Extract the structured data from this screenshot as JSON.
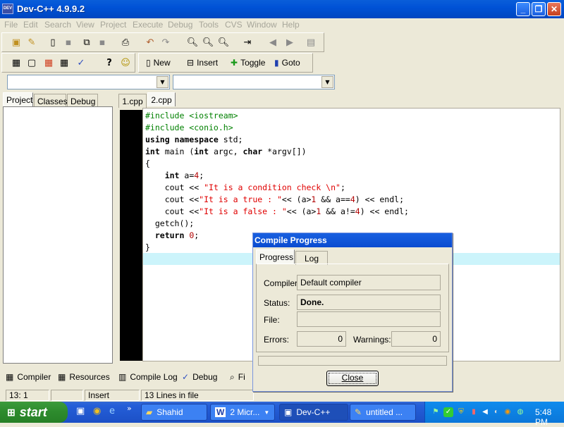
{
  "window": {
    "title": "Dev-C++ 4.9.9.2",
    "app_icon_text": "DEV",
    "minimize": "_",
    "restore": "❐",
    "close": "✕"
  },
  "menu": [
    "File",
    "Edit",
    "Search",
    "View",
    "Project",
    "Execute",
    "Debug",
    "Tools",
    "CVS",
    "Window",
    "Help"
  ],
  "toolbar2": {
    "new_label": "New",
    "insert_label": "Insert",
    "toggle_label": "Toggle",
    "goto_label": "Goto"
  },
  "left_tabs": [
    "Project",
    "Classes",
    "Debug"
  ],
  "file_tabs": [
    "1.cpp",
    "2.cpp"
  ],
  "code": [
    [
      [
        "pp",
        "#include <iostream>"
      ]
    ],
    [
      [
        "pp",
        "#include <conio.h>"
      ]
    ],
    [
      [
        "kw",
        "using namespace"
      ],
      [
        "",
        " std;"
      ]
    ],
    [
      [
        "kw",
        "int"
      ],
      [
        "",
        " main ("
      ],
      [
        "kw",
        "int"
      ],
      [
        "",
        " argc, "
      ],
      [
        "kw",
        "char"
      ],
      [
        "",
        " *argv[])"
      ]
    ],
    [
      [
        "",
        "{"
      ]
    ],
    [
      [
        "",
        "    "
      ],
      [
        "kw",
        "int"
      ],
      [
        "",
        " a="
      ],
      [
        "num",
        "4"
      ],
      [
        "",
        ";"
      ]
    ],
    [
      [
        "",
        "    cout << "
      ],
      [
        "str",
        "\"It is a condition check \\n\""
      ],
      [
        "",
        ";"
      ]
    ],
    [
      [
        "",
        "    cout <<"
      ],
      [
        "str",
        "\"It is a true : \""
      ],
      [
        "",
        "<< (a>"
      ],
      [
        "num",
        "1"
      ],
      [
        "",
        " && a=="
      ],
      [
        "num",
        "4"
      ],
      [
        "",
        ") << endl;"
      ]
    ],
    [
      [
        "",
        "    cout <<"
      ],
      [
        "str",
        "\"It is a false : \""
      ],
      [
        "",
        "<< (a>"
      ],
      [
        "num",
        "1"
      ],
      [
        "",
        " && a!="
      ],
      [
        "num",
        "4"
      ],
      [
        "",
        ") << endl;"
      ]
    ],
    [
      [
        "",
        "  getch();"
      ]
    ],
    [
      [
        "",
        "  "
      ],
      [
        "kw",
        "return"
      ],
      [
        "",
        " "
      ],
      [
        "num",
        "0"
      ],
      [
        "",
        ";"
      ]
    ],
    [
      [
        "",
        "}"
      ]
    ],
    [
      [
        "",
        ""
      ]
    ]
  ],
  "bottom_tabs": [
    "Compiler",
    "Resources",
    "Compile Log",
    "Debug",
    "Fi"
  ],
  "status": {
    "position": "13: 1",
    "mode": "Insert",
    "lines": "13 Lines in file"
  },
  "dialog": {
    "title": "Compile Progress",
    "tabs": [
      "Progress",
      "Log"
    ],
    "compiler_label": "Compiler:",
    "compiler_value": "Default compiler",
    "status_label": "Status:",
    "status_value": "Done.",
    "file_label": "File:",
    "file_value": "",
    "errors_label": "Errors:",
    "errors_value": "0",
    "warnings_label": "Warnings:",
    "warnings_value": "0",
    "close_label": "Close"
  },
  "taskbar": {
    "start_label": "start",
    "tasks": [
      "Shahid",
      "2 Micr...",
      "Dev-C++",
      "untitled ..."
    ],
    "clock": "5:48 PM"
  }
}
